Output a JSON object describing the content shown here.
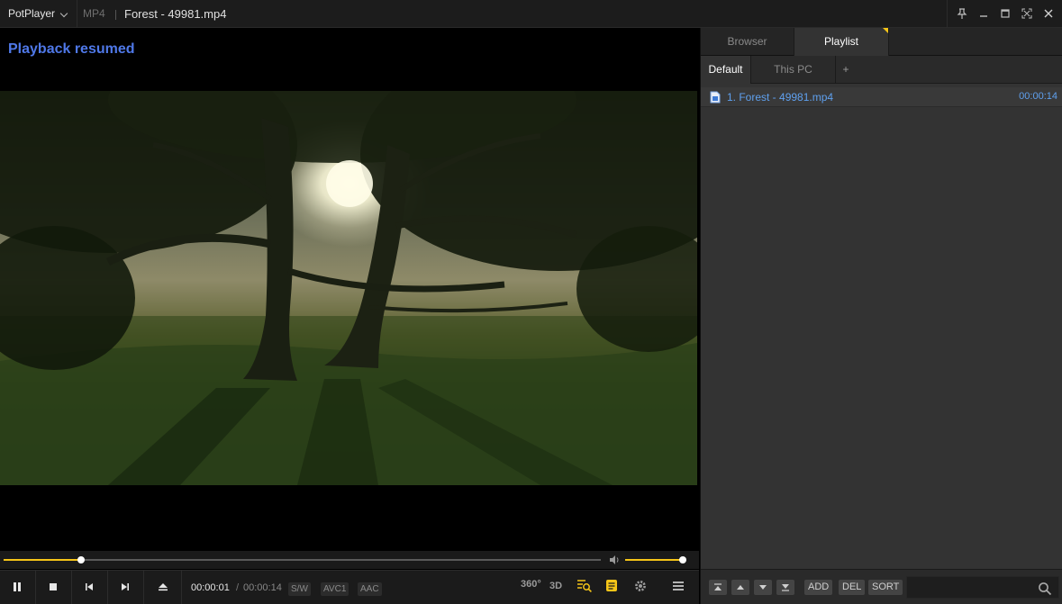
{
  "titlebar": {
    "app_name": "PotPlayer",
    "format": "MP4",
    "file_title": "Forest - 49981.mp4"
  },
  "player": {
    "osd_message": "Playback resumed",
    "time_current": "00:00:01",
    "time_separator": "/",
    "time_total": "00:00:14",
    "seek_progress": 0.13,
    "volume_level": 0.97,
    "tags": [
      "S/W",
      "AVC1",
      "AAC"
    ],
    "label_360": "360°",
    "label_3d": "3D"
  },
  "panel": {
    "tabs": [
      "Browser",
      "Playlist"
    ],
    "active_tab": "Playlist",
    "subtabs": [
      "Default",
      "This PC",
      "+"
    ],
    "playlist": [
      {
        "title": "1. Forest - 49981.mp4",
        "duration": "00:00:14"
      }
    ],
    "buttons": {
      "add": "ADD",
      "del": "DEL",
      "sort": "SORT"
    },
    "search_value": ""
  },
  "colors": {
    "accent": "#f5c518",
    "osd": "#4f78e8",
    "playlist_text": "#5fa0ee"
  }
}
